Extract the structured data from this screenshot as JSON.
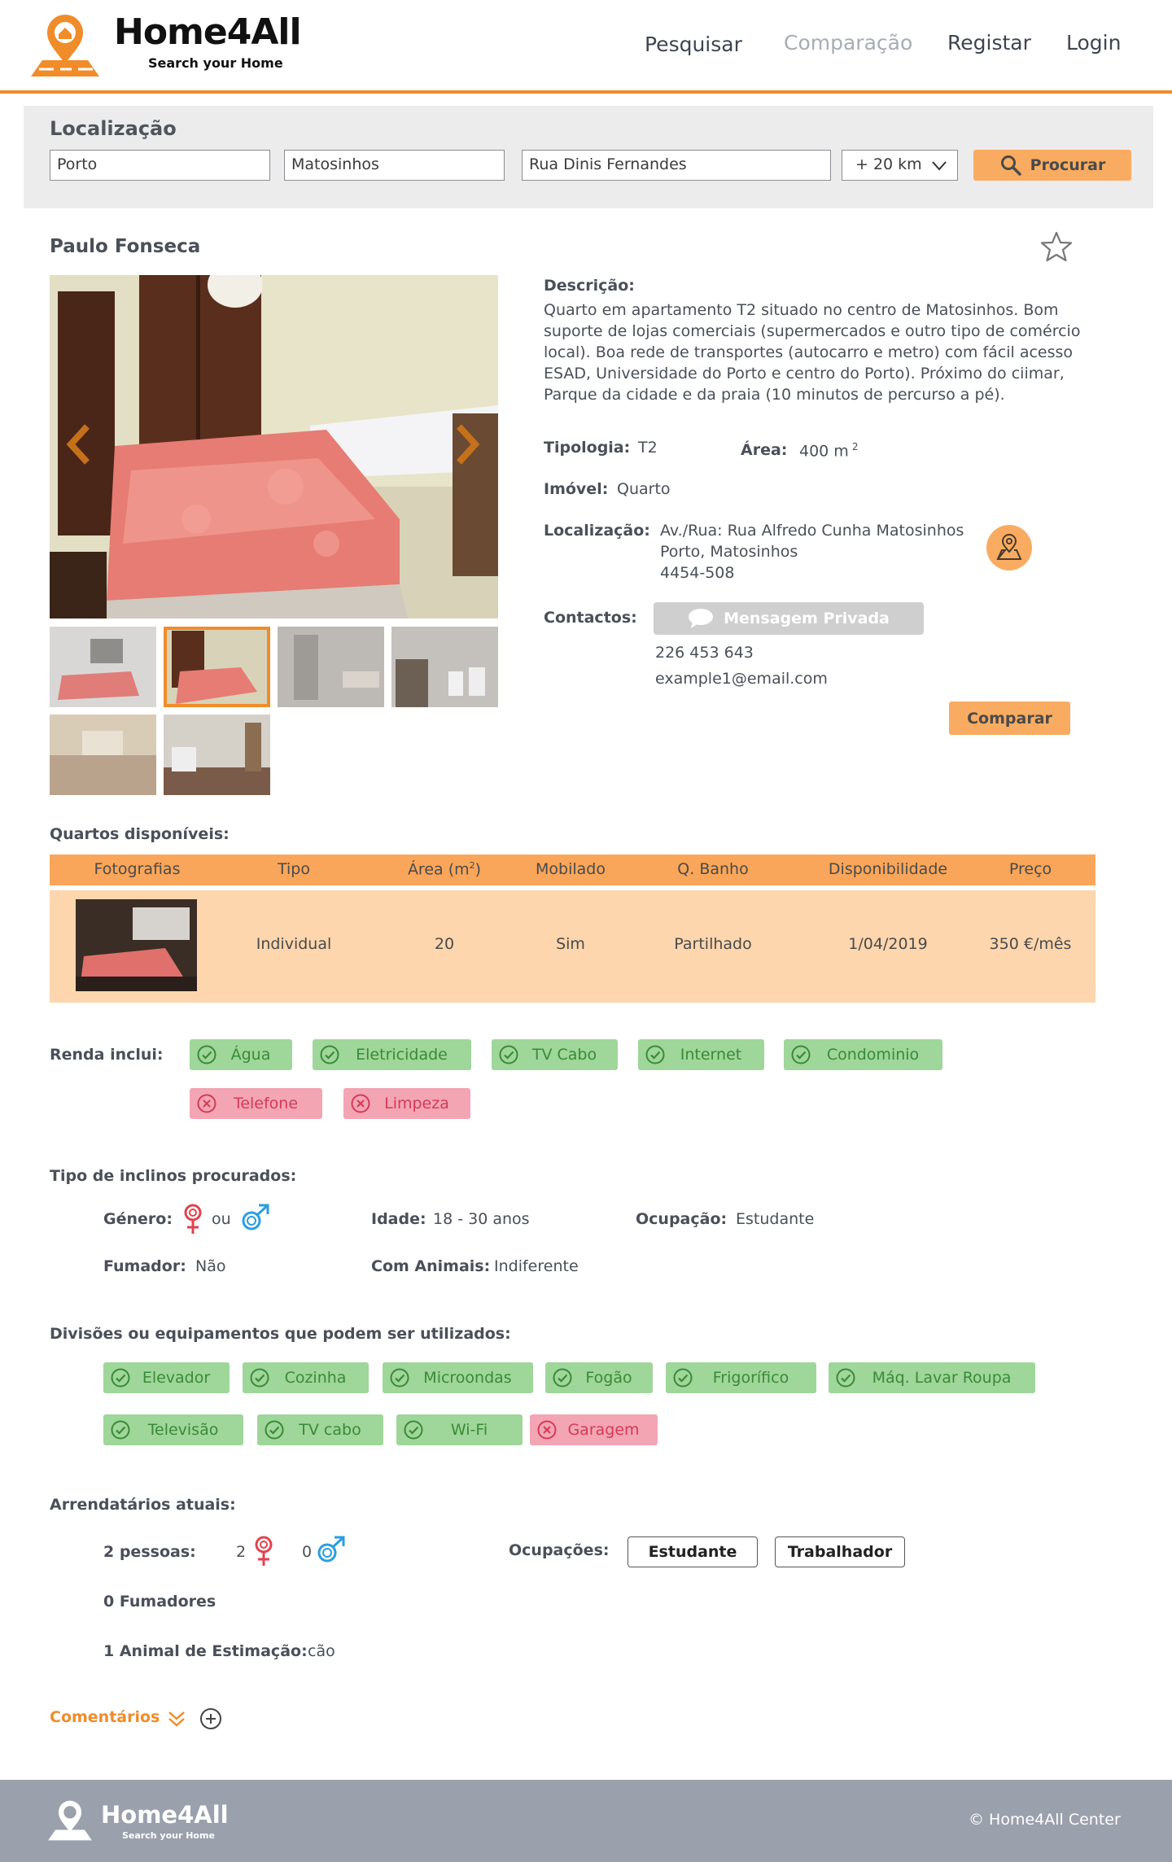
{
  "brand": {
    "name": "Home4All",
    "tagline": "Search your Home"
  },
  "nav": {
    "search": "Pesquisar",
    "compare": "Comparação",
    "register": "Registar",
    "login": "Login"
  },
  "search": {
    "title": "Localização",
    "city": "Porto",
    "district": "Matosinhos",
    "street": "Rua Dinis Fernandes",
    "radius": "+ 20 km",
    "button": "Procurar"
  },
  "listing": {
    "owner": "Paulo Fonseca",
    "description_label": "Descrição:",
    "description": "Quarto em apartamento T2 situado no centro de Matosinhos. Bom suporte de lojas comerciais (supermercados e outro tipo de comércio local). Boa rede de transportes (autocarro e metro) com fácil acesso ESAD, Universidade do Porto e centro do Porto). Próximo do ciimar, Parque da cidade e da praia (10 minutos de percurso a pé).",
    "typology_label": "Tipologia:",
    "typology": "T2",
    "area_label": "Área:",
    "area": "400 m",
    "area_sup": "2",
    "property_label": "Imóvel:",
    "property": "Quarto",
    "location_label": "Localização:",
    "address_line1": "Av./Rua: Rua Alfredo Cunha Matosinhos",
    "address_line2": "Porto, Matosinhos",
    "address_line3": "4454-508",
    "contacts_label": "Contactos:",
    "message_button": "Mensagem Privada",
    "phone": "226 453 643",
    "email": "example1@email.com",
    "compare_button": "Comparar"
  },
  "rooms": {
    "title": "Quartos disponíveis:",
    "headers": [
      "Fotografias",
      "Tipo",
      "Área (m",
      "2",
      ")",
      "Mobilado",
      "Q. Banho",
      "Disponibilidade",
      "Preço"
    ],
    "row": {
      "type": "Individual",
      "area": "20",
      "furnished": "Sim",
      "bathroom": "Partilhado",
      "availability": "1/04/2019",
      "price": "350 €/mês"
    }
  },
  "rent_includes": {
    "label": "Renda inclui:",
    "included": [
      "Água",
      "Eletricidade",
      "TV Cabo",
      "Internet",
      "Condominio"
    ],
    "excluded": [
      "Telefone",
      "Limpeza"
    ]
  },
  "tenant_profile": {
    "title": "Tipo de inclinos procurados:",
    "gender_label": "Género:",
    "gender_or": "ou",
    "age_label": "Idade:",
    "age": "18 - 30 anos",
    "occupation_label": "Ocupação:",
    "occupation": "Estudante",
    "smoker_label": "Fumador:",
    "smoker": "Não",
    "animals_label": "Com Animais:",
    "animals": "Indiferente"
  },
  "equipment": {
    "title": "Divisões ou equipamentos que podem ser utilizados:",
    "included": [
      "Elevador",
      "Cozinha",
      "Microondas",
      "Fogão",
      "Frigorífico",
      "Máq. Lavar Roupa",
      "Televisão",
      "TV cabo",
      "Wi-Fi"
    ],
    "excluded": [
      "Garagem"
    ]
  },
  "current_tenants": {
    "title": "Arrendatários atuais:",
    "people": "2 pessoas:",
    "female_count": "2",
    "male_count": "0",
    "occupations_label": "Ocupações:",
    "occupations": [
      "Estudante",
      "Trabalhador"
    ],
    "smokers": "0 Fumadores",
    "pet_label": "1 Animal de Estimação:",
    "pet": "cão"
  },
  "comments": {
    "label": "Comentários"
  },
  "footer": {
    "copyright": "© Home4All Center"
  },
  "colors": {
    "accent": "#f08c2a",
    "button": "#f9ac61",
    "ok": "#9fd69a",
    "no": "#f3a5b4",
    "footer": "#9aa0ac"
  }
}
